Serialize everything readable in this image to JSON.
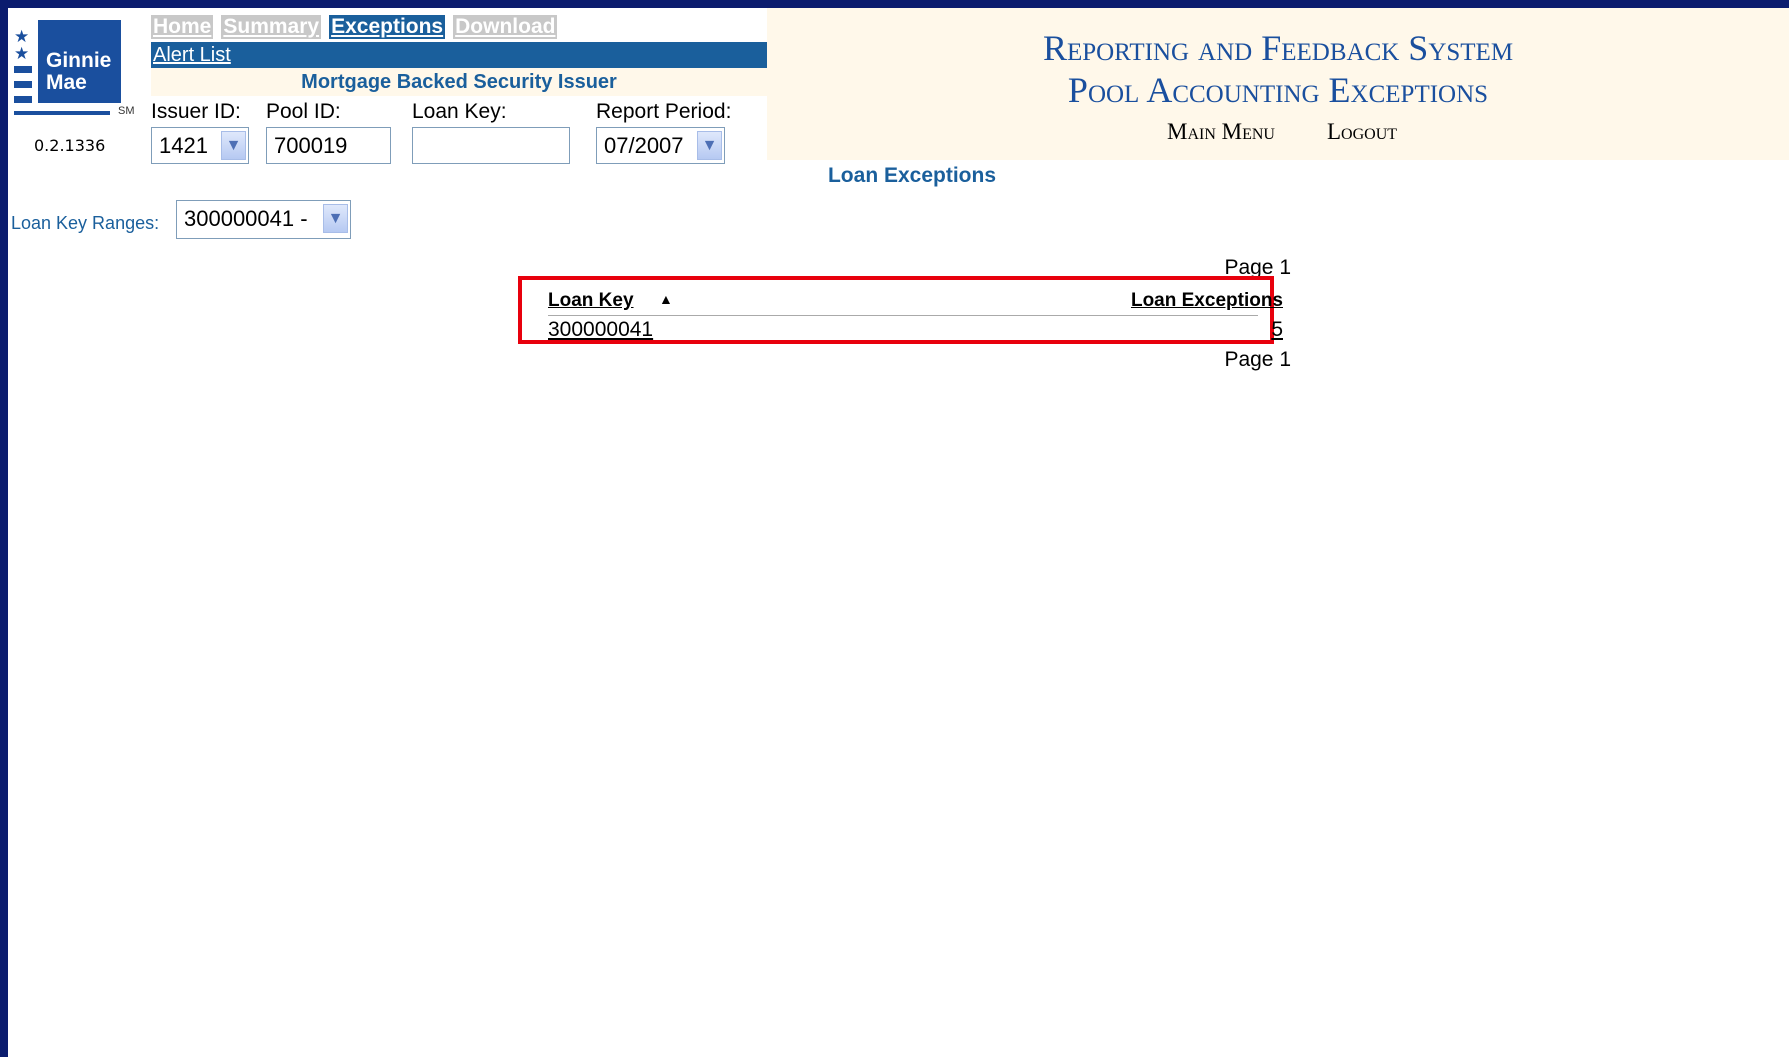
{
  "logo": {
    "text": "Ginnie Mae",
    "mark": "SM",
    "version": "0.2.1336"
  },
  "nav": {
    "tabs": [
      {
        "label": "Home",
        "active": false
      },
      {
        "label": "Summary",
        "active": false
      },
      {
        "label": "Exceptions",
        "active": true
      },
      {
        "label": "Download",
        "active": false
      }
    ],
    "alert_link": "Alert List",
    "subtitle": "Mortgage Backed Security Issuer"
  },
  "filters": {
    "issuer_label": "Issuer ID:",
    "issuer_value": "1421",
    "pool_label": "Pool ID:",
    "pool_value": "700019",
    "loankey_label": "Loan Key:",
    "loankey_value": "",
    "period_label": "Report Period:",
    "period_value": "07/2007"
  },
  "system": {
    "title_line1": "Reporting and Feedback System",
    "title_line2": "Pool Accounting Exceptions",
    "main_menu": "Main Menu",
    "logout": "Logout"
  },
  "page_title": "Loan Exceptions",
  "ranges": {
    "label": "Loan Key Ranges:",
    "value": "300000041 -"
  },
  "table": {
    "page_top": "Page 1",
    "page_bottom": "Page 1",
    "col_key": "Loan Key",
    "col_exceptions": "Loan Exceptions",
    "rows": [
      {
        "loan_key": "300000041",
        "exceptions": "5"
      }
    ]
  },
  "colors": {
    "frame": "#0b1c6e",
    "brand_blue": "#1a5f9c",
    "highlight": "#e8000d",
    "cream": "#fff8ea"
  },
  "icons": [
    "star-icon",
    "dropdown-arrow-icon",
    "sort-ascending-icon"
  ]
}
